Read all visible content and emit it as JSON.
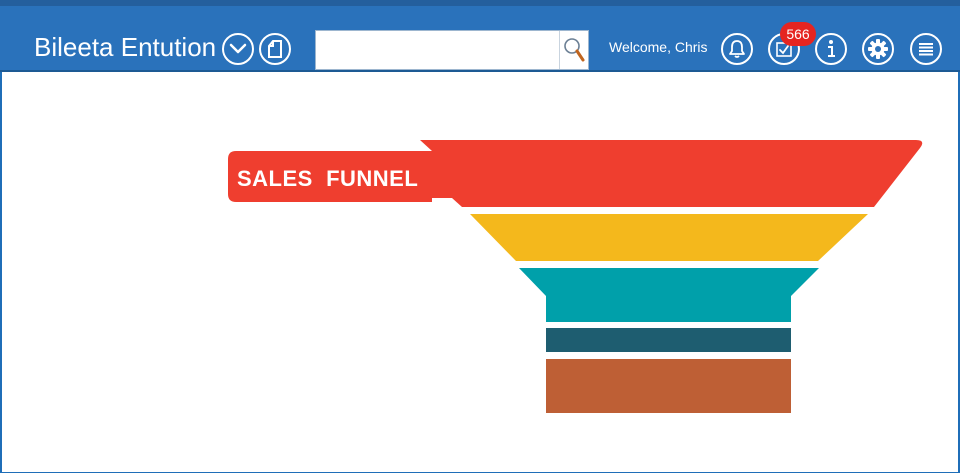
{
  "header": {
    "app_title": "Bileeta Entution",
    "welcome_text": "Welcome, Chris",
    "tasks_badge_count": "566",
    "search": {
      "value": "",
      "placeholder": ""
    }
  },
  "icons": {
    "dropdown": "chevron-down-icon",
    "new_document": "document-icon",
    "search": "search-icon",
    "notifications": "bell-icon",
    "tasks": "task-check-icon",
    "info": "info-icon",
    "settings": "gear-icon",
    "menu": "menu-icon"
  },
  "funnel": {
    "title": "SALES  FUNNEL",
    "stages": [
      {
        "color": "#ef3e2f"
      },
      {
        "color": "#f4b81c"
      },
      {
        "color": "#00a0aa"
      },
      {
        "color": "#1e5d70"
      },
      {
        "color": "#be5f35"
      }
    ]
  },
  "colors": {
    "header_bg": "#2a72bb",
    "badge_bg": "#e52521"
  }
}
